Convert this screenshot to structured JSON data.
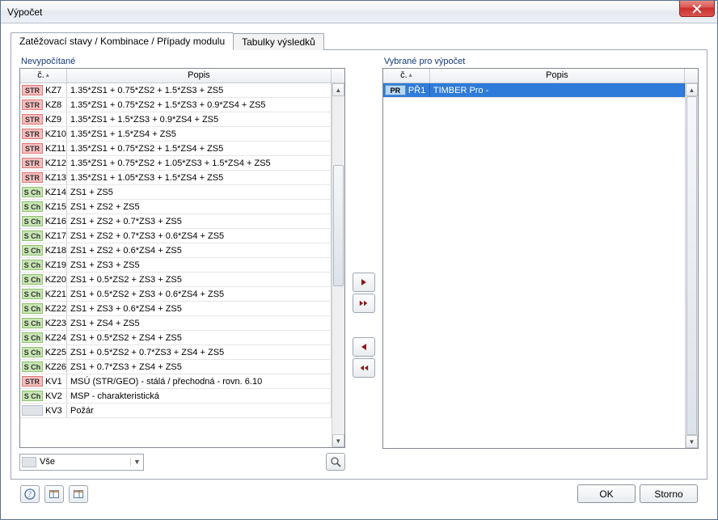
{
  "window": {
    "title": "Výpočet"
  },
  "tabs": {
    "active": "Zatěžovací stavy / Kombinace / Případy modulu",
    "other": "Tabulky výsledků"
  },
  "left": {
    "heading": "Nevypočítané",
    "col_num": "č.",
    "col_desc": "Popis",
    "rows": [
      {
        "type": "STR",
        "code": "KZ7",
        "desc": "1.35*ZS1 + 0.75*ZS2 + 1.5*ZS3 + ZS5"
      },
      {
        "type": "STR",
        "code": "KZ8",
        "desc": "1.35*ZS1 + 0.75*ZS2 + 1.5*ZS3 + 0.9*ZS4 + ZS5"
      },
      {
        "type": "STR",
        "code": "KZ9",
        "desc": "1.35*ZS1 + 1.5*ZS3 + 0.9*ZS4 + ZS5"
      },
      {
        "type": "STR",
        "code": "KZ10",
        "desc": "1.35*ZS1 + 1.5*ZS4 + ZS5"
      },
      {
        "type": "STR",
        "code": "KZ11",
        "desc": "1.35*ZS1 + 0.75*ZS2 + 1.5*ZS4 + ZS5"
      },
      {
        "type": "STR",
        "code": "KZ12",
        "desc": "1.35*ZS1 + 0.75*ZS2 + 1.05*ZS3 + 1.5*ZS4 + ZS5"
      },
      {
        "type": "STR",
        "code": "KZ13",
        "desc": "1.35*ZS1 + 1.05*ZS3 + 1.5*ZS4 + ZS5"
      },
      {
        "type": "SCh",
        "code": "KZ14",
        "desc": "ZS1 + ZS5"
      },
      {
        "type": "SCh",
        "code": "KZ15",
        "desc": "ZS1 + ZS2 + ZS5"
      },
      {
        "type": "SCh",
        "code": "KZ16",
        "desc": "ZS1 + ZS2 + 0.7*ZS3 + ZS5"
      },
      {
        "type": "SCh",
        "code": "KZ17",
        "desc": "ZS1 + ZS2 + 0.7*ZS3 + 0.6*ZS4 + ZS5"
      },
      {
        "type": "SCh",
        "code": "KZ18",
        "desc": "ZS1 + ZS2 + 0.6*ZS4 + ZS5"
      },
      {
        "type": "SCh",
        "code": "KZ19",
        "desc": "ZS1 + ZS3 + ZS5"
      },
      {
        "type": "SCh",
        "code": "KZ20",
        "desc": "ZS1 + 0.5*ZS2 + ZS3 + ZS5"
      },
      {
        "type": "SCh",
        "code": "KZ21",
        "desc": "ZS1 + 0.5*ZS2 + ZS3 + 0.6*ZS4 + ZS5"
      },
      {
        "type": "SCh",
        "code": "KZ22",
        "desc": "ZS1 + ZS3 + 0.6*ZS4 + ZS5"
      },
      {
        "type": "SCh",
        "code": "KZ23",
        "desc": "ZS1 + ZS4 + ZS5"
      },
      {
        "type": "SCh",
        "code": "KZ24",
        "desc": "ZS1 + 0.5*ZS2 + ZS4 + ZS5"
      },
      {
        "type": "SCh",
        "code": "KZ25",
        "desc": "ZS1 + 0.5*ZS2 + 0.7*ZS3 + ZS4 + ZS5"
      },
      {
        "type": "SCh",
        "code": "KZ26",
        "desc": "ZS1 + 0.7*ZS3 + ZS4 + ZS5"
      },
      {
        "type": "STR",
        "code": "KV1",
        "desc": "MSÚ (STR/GEO) - stálá / přechodná - rovn. 6.10"
      },
      {
        "type": "SCh",
        "code": "KV2",
        "desc": "MSP - charakteristická"
      },
      {
        "type": "",
        "code": "KV3",
        "desc": "Požár"
      }
    ]
  },
  "right": {
    "heading": "Vybrané pro výpočet",
    "col_num": "č.",
    "col_desc": "Popis",
    "rows": [
      {
        "type": "PR",
        "code": "PŘ1",
        "desc": "TIMBER Pro -",
        "selected": true
      }
    ]
  },
  "filter": {
    "value": "Vše"
  },
  "buttons": {
    "ok": "OK",
    "cancel": "Storno"
  }
}
